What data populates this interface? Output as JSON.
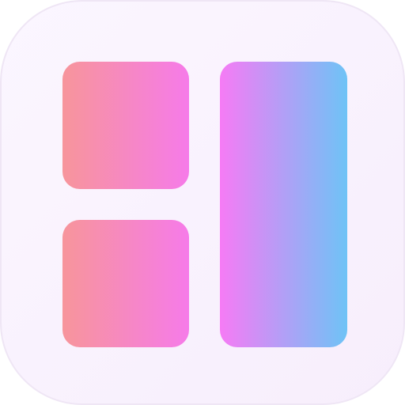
{
  "icon": {
    "name": "layout-grid-app-icon",
    "tile": {
      "background_start": "#fbf6ff",
      "background_end": "#f7eefc",
      "border_color": "#efe6f5"
    },
    "blocks": [
      {
        "id": "top-left",
        "gradient": [
          "#f7959b",
          "#f67be9"
        ]
      },
      {
        "id": "bottom-left",
        "gradient": [
          "#f7959b",
          "#f67be9"
        ]
      },
      {
        "id": "right",
        "gradient": [
          "#f67bf5",
          "#6ec3f6"
        ]
      }
    ]
  }
}
